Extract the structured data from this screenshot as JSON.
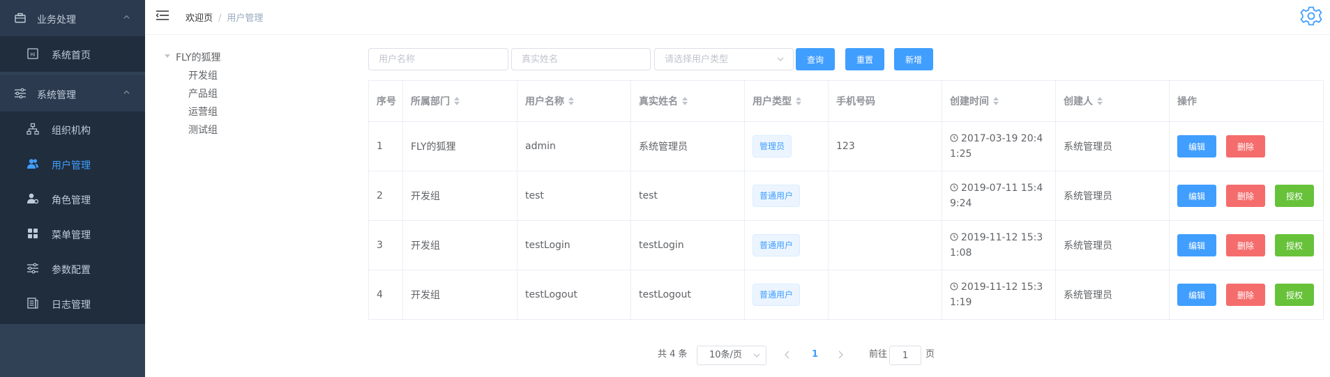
{
  "sidebar": {
    "groups": [
      {
        "label": "业务处理",
        "items": [
          {
            "label": "系统首页"
          }
        ]
      },
      {
        "label": "系统管理",
        "items": [
          {
            "label": "组织机构"
          },
          {
            "label": "用户管理"
          },
          {
            "label": "角色管理"
          },
          {
            "label": "菜单管理"
          },
          {
            "label": "参数配置"
          },
          {
            "label": "日志管理"
          }
        ]
      }
    ],
    "active_item": "用户管理",
    "colors": {
      "bg": "#304156",
      "submenu_bg": "#1f2d3d",
      "active": "#409eff"
    }
  },
  "header": {
    "breadcrumb": {
      "home": "欢迎页",
      "separator": "/",
      "current": "用户管理"
    },
    "icons": {
      "menu": "hamburger-icon",
      "settings": "gear-icon"
    }
  },
  "tree": {
    "root": "FLY的狐狸",
    "children": [
      "开发组",
      "产品组",
      "运营组",
      "测试组"
    ]
  },
  "filters": {
    "username_placeholder": "用户名称",
    "realname_placeholder": "真实姓名",
    "usertype_placeholder": "请选择用户类型",
    "buttons": {
      "query": "查询",
      "reset": "重置",
      "add": "新增"
    }
  },
  "table": {
    "headers": [
      "序号",
      "所属部门",
      "用户名称",
      "真实姓名",
      "用户类型",
      "手机号码",
      "创建时间",
      "创建人",
      "操作"
    ],
    "rows": [
      {
        "index": "1",
        "dept": "FLY的狐狸",
        "username": "admin",
        "realname": "系统管理员",
        "type": "管理员",
        "phone": "123",
        "created": "2017-03-19 20:41:25",
        "creator": "系统管理员"
      },
      {
        "index": "2",
        "dept": "开发组",
        "username": "test",
        "realname": "test",
        "type": "普通用户",
        "phone": "",
        "created": "2019-07-11 15:49:24",
        "creator": "系统管理员"
      },
      {
        "index": "3",
        "dept": "开发组",
        "username": "testLogin",
        "realname": "testLogin",
        "type": "普通用户",
        "phone": "",
        "created": "2019-11-12 15:31:08",
        "creator": "系统管理员"
      },
      {
        "index": "4",
        "dept": "开发组",
        "username": "testLogout",
        "realname": "testLogout",
        "type": "普通用户",
        "phone": "",
        "created": "2019-11-12 15:31:19",
        "creator": "系统管理员"
      }
    ],
    "actions": {
      "edit": "编辑",
      "delete": "删除",
      "grant": "授权"
    },
    "colors": {
      "edit": "#409eff",
      "delete": "#f56c6c",
      "grant": "#67c23a"
    }
  },
  "pagination": {
    "total_text": "共 4 条",
    "page_size": "10条/页",
    "current_page": "1",
    "goto_prefix": "前往",
    "goto_value": "1",
    "goto_suffix": "页"
  }
}
